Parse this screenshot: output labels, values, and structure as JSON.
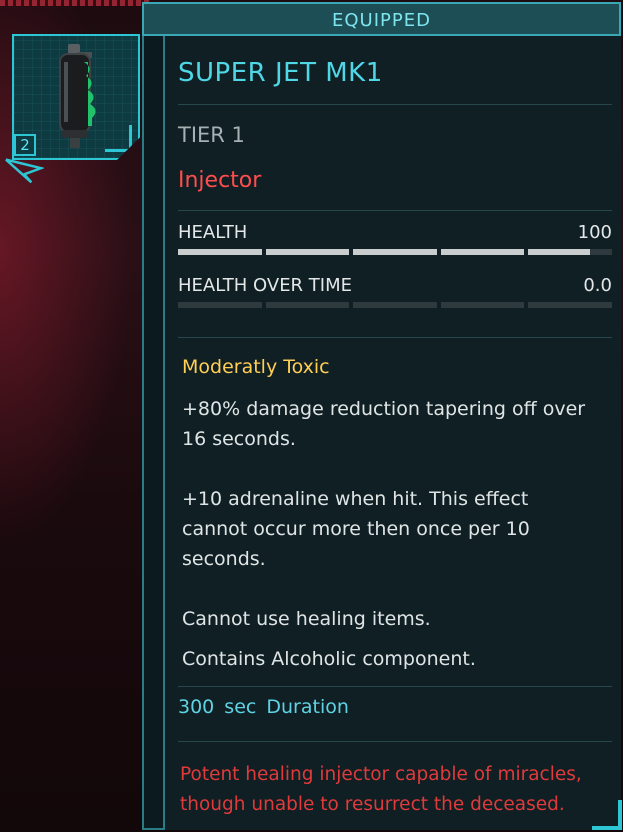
{
  "slot": {
    "icon": "injector-icon",
    "stack_count": "2"
  },
  "tooltip": {
    "equipped_label": "EQUIPPED",
    "item_name": "SUPER JET MK1",
    "tier": "TIER 1",
    "item_type": "Injector",
    "stats": [
      {
        "label": "HEALTH",
        "value": "100",
        "fill_fraction": 0.95
      },
      {
        "label": "HEALTH OVER TIME",
        "value": "0.0",
        "fill_fraction": 0.0
      }
    ],
    "effect_title": "Moderatly Toxic",
    "effect_lines": [
      "+80% damage reduction tapering off over 16 seconds.",
      "+10 adrenaline when hit. This effect cannot occur more then once per 10 seconds.",
      "Cannot use healing items.",
      "Contains Alcoholic component."
    ],
    "duration": "300 sec Duration",
    "description": "Potent healing injector capable of miracles, though unable to resurrect the deceased."
  },
  "colors": {
    "accent_cyan": "#2cc6d4",
    "title_cyan": "#4fd7e6",
    "type_red": "#ff4d4d",
    "effect_yellow": "#ffce54",
    "description_red": "#e03a3a"
  }
}
